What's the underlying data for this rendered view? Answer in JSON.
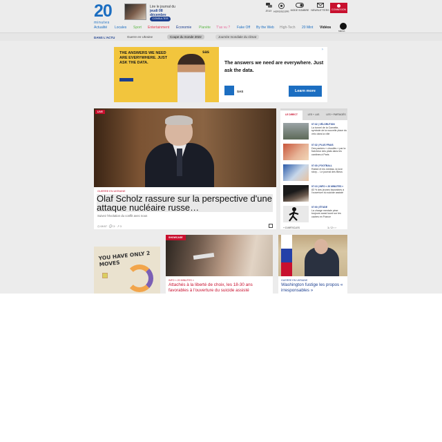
{
  "header": {
    "logo_number": "20",
    "logo_sub": "minutes",
    "journal_line1": "Lire le journal du",
    "journal_line2": "jeudi 08 décembre",
    "journal_button": "CONSULTER",
    "tools": [
      {
        "label": "JEUX",
        "icon": "chat-bubbles-icon"
      },
      {
        "label": "HOROSCOPE",
        "icon": "zodiac-wheel-icon"
      },
      {
        "label": "MODE SOMBRE",
        "icon": "dark-mode-toggle-icon"
      },
      {
        "label": "NEWSLETTERS",
        "icon": "envelope-icon"
      },
      {
        "label": "CONNEXION",
        "icon": "user-icon"
      }
    ],
    "nav": [
      {
        "label": "Actualité",
        "color": "#1c6ec1"
      },
      {
        "label": "Locales",
        "color": "#1c6ec1"
      },
      {
        "label": "Sport",
        "color": "#5fb84a"
      },
      {
        "label": "Entertainment",
        "color": "#e8334a"
      },
      {
        "label": "Économie",
        "color": "#1c3f8f"
      },
      {
        "label": "Planète",
        "color": "#5fb84a"
      },
      {
        "label": "T'as vu ?",
        "color": "#e8679a"
      },
      {
        "label": "Fake Off",
        "color": "#1c6ec1"
      },
      {
        "label": "By the Web",
        "color": "#1c6ec1"
      },
      {
        "label": "High-Tech",
        "color": "#888888"
      },
      {
        "label": "20 Mint",
        "color": "#1c6ec1"
      },
      {
        "label": "Vidéos",
        "color": "#111111"
      }
    ],
    "media_label": "MÉDIA"
  },
  "subnav": {
    "label": "DANS L'ACTU",
    "chips": [
      "Guerre en Ukraine",
      "Coupe du monde 2022",
      "Journée mondiale du climat"
    ]
  },
  "ad": {
    "left_text": "THE ANSWERS WE NEED ARE EVERYWHERE. JUST ASK THE DATA.",
    "brand_top": "sas",
    "headline": "The answers we need are everywhere. Just ask the data.",
    "brand": "SAS",
    "cta": "Learn more",
    "mark": "▷"
  },
  "main_article": {
    "badge": "LIVE",
    "category": "GUERRE EN UKRAINE",
    "title": "Olaf Scholz rassure sur la perspective d'une attaque nucléaire russe…",
    "subtitle": "Suivez l'évolution du conflit avec nous",
    "meta": "◷ 08:57 · 💬 3 · ↗ 3"
  },
  "live_panel": {
    "tabs": [
      "LE DIRECT",
      "LES + LUS",
      "LES + PARTAGÉS"
    ],
    "items": [
      {
        "meta": "07:32 | VÉLORUTION",
        "text": "La tunnel de la Cornette, symbole de la nouvelle place du vélo dans la ville"
      },
      {
        "meta": "07:32 | PLUS FRAIS",
        "text": "Des paniers « chouilés » par la fraîcheur des plats dans les cantines à Paris"
      },
      {
        "meta": "07:30 | FOOTBALL",
        "text": "Rabiot et les médias, la love story… Le journal des Bleus"
      },
      {
        "meta": "07:10 | INFO « 20 MINUTES »",
        "text": "83 % des jeunes favorables à l'ouverture du suicide assisté"
      },
      {
        "meta": "07:00 | ÉTUDE",
        "text": "La charge mentale pèse toujours aussi lourd sur les cadres en France"
      }
    ],
    "footer": "+ D'ARTICLES",
    "pager": "1 / 2 ‹ ›"
  },
  "cards": {
    "c1_text": "YOU HAVE ONLY 2 MOVES",
    "c2_tag": "SHOWCASE",
    "c2_meta": "INFO « 20 MINUTES »",
    "c2_title": "Attachés à la liberté de choix, les 18-30 ans favorables à l'ouverture du suicide assisté",
    "c3_meta": "GUERRE EN UKRAINE",
    "c3_title": "Washington fustige les propos « irresponsables »"
  }
}
